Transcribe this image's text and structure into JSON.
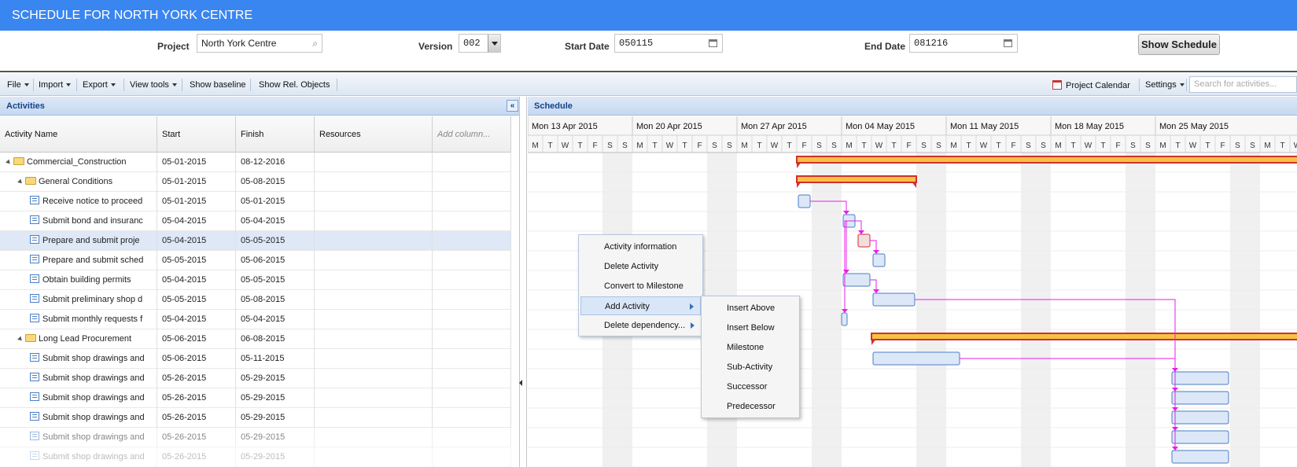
{
  "app": {
    "title": "SCHEDULE FOR NORTH YORK CENTRE"
  },
  "params": {
    "project_label": "Project",
    "project_value": "North York Centre",
    "version_label": "Version",
    "version_value": "002",
    "start_label": "Start Date",
    "start_value": "050115",
    "end_label": "End Date",
    "end_value": "081216",
    "show_button": "Show Schedule"
  },
  "toolbar": {
    "file": "File",
    "import": "Import",
    "export": "Export",
    "view_tools": "View tools",
    "show_baseline": "Show baseline",
    "show_rel": "Show Rel. Objects",
    "project_calendar": "Project Calendar",
    "settings": "Settings",
    "search_placeholder": "Search for activities..."
  },
  "activities_panel": {
    "title": "Activities"
  },
  "schedule_panel": {
    "title": "Schedule"
  },
  "columns": [
    "Activity Name",
    "Start",
    "Finish",
    "Resources",
    "Add column..."
  ],
  "rows": [
    {
      "name": "Commercial_Construction",
      "start": "05-01-2015",
      "finish": "08-12-2016",
      "type": "folder",
      "level": 0
    },
    {
      "name": "General Conditions",
      "start": "05-01-2015",
      "finish": "05-08-2015",
      "type": "folder",
      "level": 1
    },
    {
      "name": "Receive notice to proceed",
      "start": "05-01-2015",
      "finish": "05-01-2015",
      "type": "task",
      "level": 2
    },
    {
      "name": "Submit bond and insuranc",
      "start": "05-04-2015",
      "finish": "05-04-2015",
      "type": "task",
      "level": 2
    },
    {
      "name": "Prepare and submit proje",
      "start": "05-04-2015",
      "finish": "05-05-2015",
      "type": "task",
      "level": 2,
      "selected": true
    },
    {
      "name": "Prepare and submit sched",
      "start": "05-05-2015",
      "finish": "05-06-2015",
      "type": "task",
      "level": 2
    },
    {
      "name": "Obtain building permits",
      "start": "05-04-2015",
      "finish": "05-05-2015",
      "type": "task",
      "level": 2
    },
    {
      "name": "Submit preliminary shop d",
      "start": "05-05-2015",
      "finish": "05-08-2015",
      "type": "task",
      "level": 2
    },
    {
      "name": "Submit monthly requests f",
      "start": "05-04-2015",
      "finish": "05-04-2015",
      "type": "task",
      "level": 2
    },
    {
      "name": "Long Lead Procurement",
      "start": "05-06-2015",
      "finish": "06-08-2015",
      "type": "folder",
      "level": 1
    },
    {
      "name": "Submit shop drawings and",
      "start": "05-06-2015",
      "finish": "05-11-2015",
      "type": "task",
      "level": 2
    },
    {
      "name": "Submit shop drawings and",
      "start": "05-26-2015",
      "finish": "05-29-2015",
      "type": "task",
      "level": 2
    },
    {
      "name": "Submit shop drawings and",
      "start": "05-26-2015",
      "finish": "05-29-2015",
      "type": "task",
      "level": 2
    },
    {
      "name": "Submit shop drawings and",
      "start": "05-26-2015",
      "finish": "05-29-2015",
      "type": "task",
      "level": 2
    },
    {
      "name": "Submit shop drawings and",
      "start": "05-26-2015",
      "finish": "05-29-2015",
      "type": "task",
      "level": 2,
      "faded": true
    },
    {
      "name": "Submit shop drawings and",
      "start": "05-26-2015",
      "finish": "05-29-2015",
      "type": "task",
      "level": 2,
      "faded": true
    }
  ],
  "timeline": {
    "weeks": [
      "Mon 13 Apr 2015",
      "Mon 20 Apr 2015",
      "Mon 27 Apr 2015",
      "Mon 04 May 2015",
      "Mon 11 May 2015",
      "Mon 18 May 2015",
      "Mon 25 May 2015"
    ],
    "day_letters": [
      "M",
      "T",
      "W",
      "T",
      "F",
      "S",
      "S"
    ]
  },
  "gantt_bars": [
    {
      "row": 0,
      "type": "summary",
      "start": "05-01-2015",
      "end": "07-01-2015"
    },
    {
      "row": 1,
      "type": "summary",
      "start": "05-01-2015",
      "end": "05-08-2015"
    },
    {
      "row": 2,
      "type": "task",
      "start": "05-01-2015",
      "end": "05-01-2015"
    },
    {
      "row": 3,
      "type": "task",
      "start": "05-04-2015",
      "end": "05-04-2015"
    },
    {
      "row": 4,
      "type": "critical",
      "start": "05-05-2015",
      "end": "05-05-2015"
    },
    {
      "row": 5,
      "type": "task",
      "start": "05-06-2015",
      "end": "05-06-2015"
    },
    {
      "row": 6,
      "type": "task",
      "start": "05-04-2015",
      "end": "05-05-2015"
    },
    {
      "row": 7,
      "type": "task",
      "start": "05-06-2015",
      "end": "05-08-2015"
    },
    {
      "row": 8,
      "type": "milestone",
      "start": "05-04-2015",
      "end": "05-04-2015"
    },
    {
      "row": 9,
      "type": "summary",
      "start": "05-06-2015",
      "end": "07-01-2015"
    },
    {
      "row": 10,
      "type": "task",
      "start": "05-06-2015",
      "end": "05-11-2015"
    },
    {
      "row": 11,
      "type": "task",
      "start": "05-26-2015",
      "end": "05-29-2015"
    },
    {
      "row": 12,
      "type": "task",
      "start": "05-26-2015",
      "end": "05-29-2015"
    },
    {
      "row": 13,
      "type": "task",
      "start": "05-26-2015",
      "end": "05-29-2015"
    },
    {
      "row": 14,
      "type": "task",
      "start": "05-26-2015",
      "end": "05-29-2015"
    },
    {
      "row": 15,
      "type": "task",
      "start": "05-26-2015",
      "end": "05-29-2015"
    }
  ],
  "context_menu": {
    "items": [
      "Activity information",
      "Delete Activity",
      "Convert to Milestone",
      "Add Activity",
      "Delete dependency..."
    ],
    "highlighted": "Add Activity",
    "submenu": [
      "Insert Above",
      "Insert Below",
      "Milestone",
      "Sub-Activity",
      "Successor",
      "Predecessor"
    ]
  },
  "colors": {
    "header_blue": "#3a86f0",
    "summary_bar": "#f5c242",
    "critical_bar": "#d32f2f",
    "link": "#e81ee8",
    "task_fill": "#dce7f7",
    "task_border": "#4a7ec4"
  }
}
